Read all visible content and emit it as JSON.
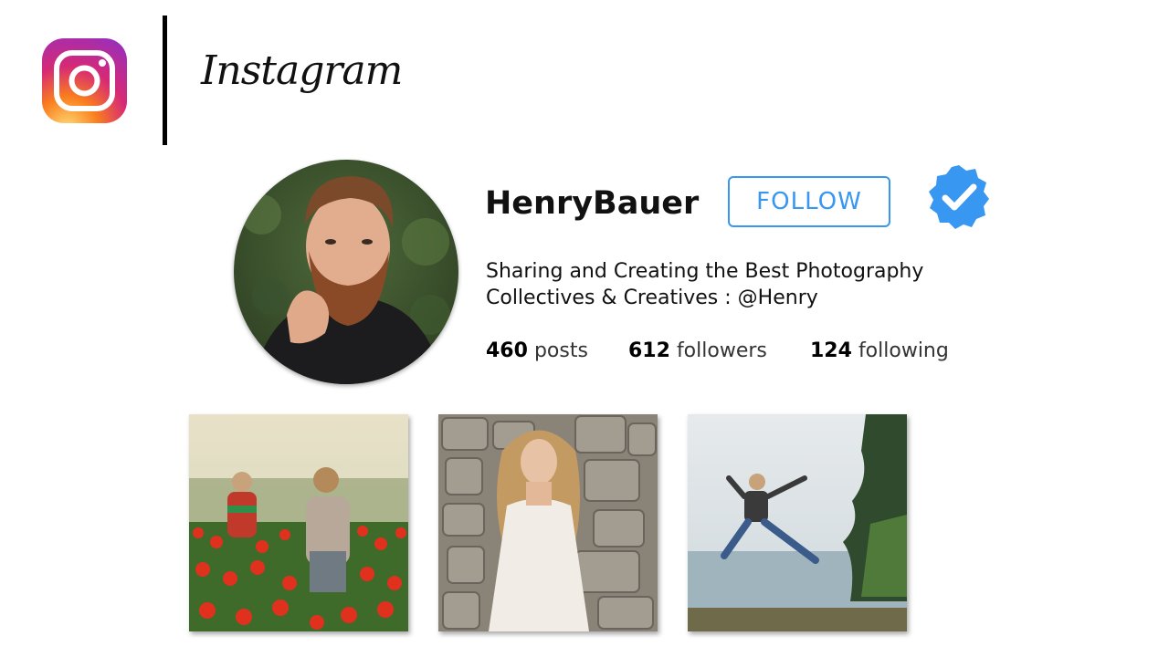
{
  "brand": {
    "name": "Instagram",
    "logo_icon": "instagram-logo-icon",
    "gradient_colors": [
      "#feda75",
      "#fa7e1e",
      "#d62976",
      "#962fbf"
    ]
  },
  "profile": {
    "username": "HenryBauer",
    "follow_label": "FOLLOW",
    "verified_icon": "verified-badge-icon",
    "accent_color": "#3897f0",
    "bio_lines": [
      "Sharing and Creating the Best Photography",
      "Collectives & Creatives : @Henry"
    ],
    "stats": [
      {
        "count": "460",
        "label": "posts"
      },
      {
        "count": "612",
        "label": "followers"
      },
      {
        "count": "124",
        "label": "following"
      }
    ]
  },
  "posts": [
    {
      "image": "tulip-field-children-photo"
    },
    {
      "image": "woman-stone-wall-photo"
    },
    {
      "image": "jumping-person-lake-photo"
    }
  ]
}
